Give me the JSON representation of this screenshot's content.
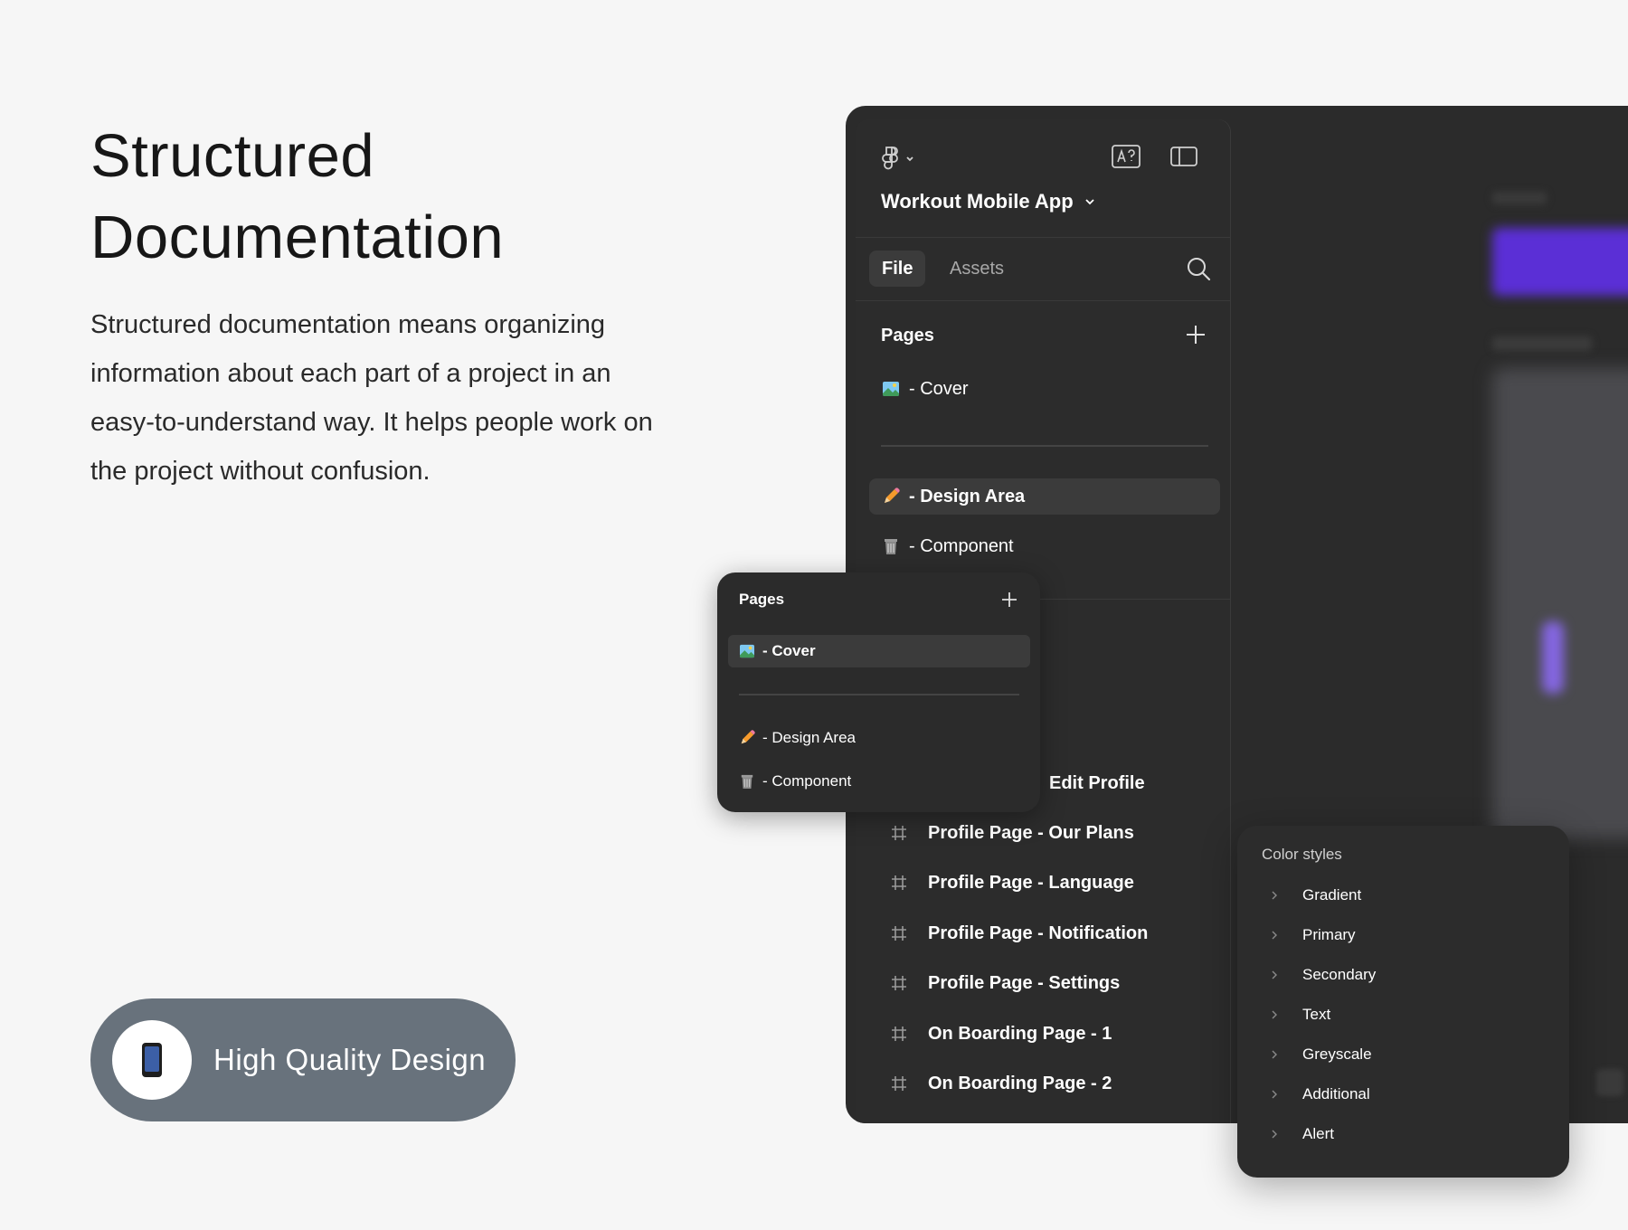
{
  "hero": {
    "title_line1": "Structured",
    "title_line2": "Documentation",
    "description": "Structured documentation means organizing information about each part of a project in an easy-to-understand way. It helps people work on the project without confusion."
  },
  "badge": {
    "label": "High Quality Design",
    "icon": "mobile-phone-icon"
  },
  "app": {
    "project_title": "Workout Mobile App",
    "tabs": {
      "file": "File",
      "assets": "Assets"
    },
    "pages_header": "Pages",
    "pages": [
      {
        "emoji": "picture-icon",
        "label": "- Cover"
      },
      {
        "emoji": "pencil-icon",
        "label": "- Design Area"
      },
      {
        "emoji": "trash-icon",
        "label": "- Component"
      }
    ],
    "frames": [
      "Edit Profile",
      "Profile Page - Our Plans",
      "Profile Page - Language",
      "Profile Page - Notification",
      "Profile Page - Settings",
      "On Boarding Page - 1",
      "On Boarding Page - 2"
    ]
  },
  "popup": {
    "title": "Pages",
    "pages": [
      {
        "emoji": "picture-icon",
        "label": "- Cover"
      },
      {
        "emoji": "pencil-icon",
        "label": "- Design Area"
      },
      {
        "emoji": "trash-icon",
        "label": "- Component"
      }
    ]
  },
  "color_styles": {
    "title": "Color styles",
    "items": [
      "Gradient",
      "Primary",
      "Secondary",
      "Text",
      "Greyscale",
      "Additional",
      "Alert"
    ]
  },
  "colors": {
    "background": "#f6f6f6",
    "panel": "#2c2c2c",
    "badge": "#68727c",
    "accent": "#5b2fd6"
  }
}
